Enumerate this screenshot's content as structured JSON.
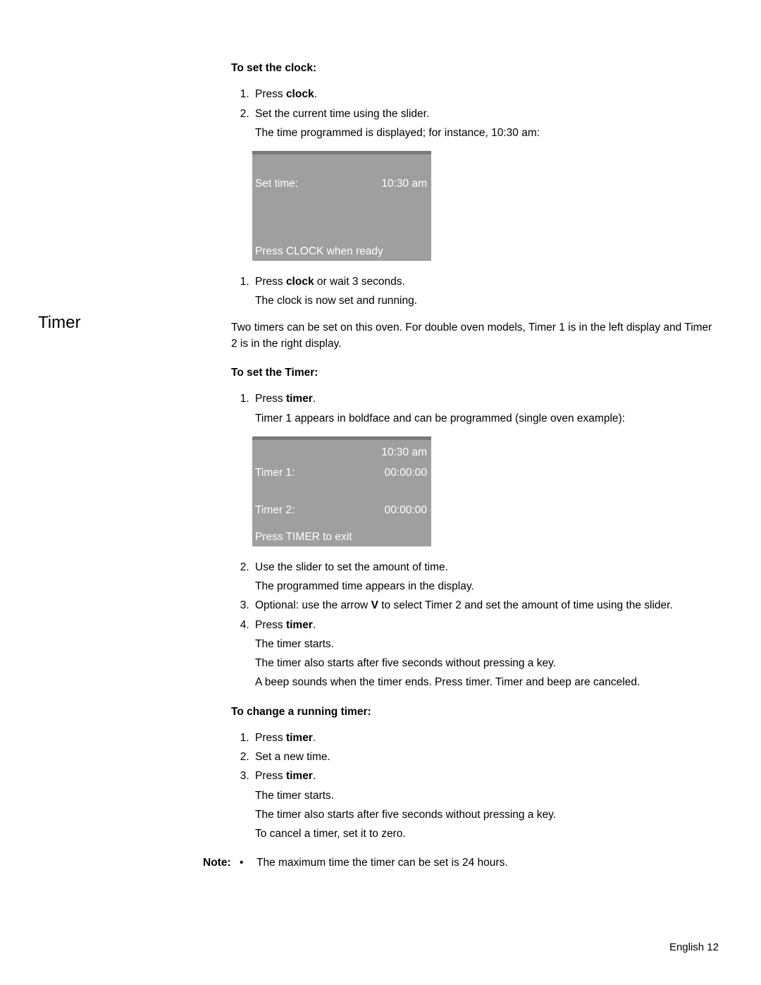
{
  "section1": {
    "heading": "To set the clock:",
    "steps_a": [
      {
        "pre": "Press ",
        "bold": "clock",
        "post": "."
      },
      {
        "text": "Set the current time using the slider.",
        "sub": "The time programmed is displayed; for instance, 10:30 am:"
      }
    ],
    "display": {
      "row1_left": "Set time:",
      "row1_right": "10:30 am",
      "bottom": "Press CLOCK when ready"
    },
    "steps_b": [
      {
        "pre": "Press ",
        "bold": "clock",
        "post": " or wait 3 seconds.",
        "sub": "The clock is now set and running."
      }
    ]
  },
  "section2": {
    "title": "Timer",
    "intro": "Two timers can be set on this oven. For double oven models, Timer 1 is in the left display and Timer 2 is in the right display.",
    "heading": "To set the Timer:",
    "steps_a": [
      {
        "pre": "Press ",
        "bold": "timer",
        "post": ".",
        "sub": "Timer 1 appears in boldface and can be programmed (single oven example):"
      }
    ],
    "display": {
      "top_right": "10:30 am",
      "row1_left": "Timer 1:",
      "row1_right": "00:00:00",
      "row2_left": "Timer 2:",
      "row2_right": "00:00:00",
      "bottom": "Press TIMER to exit"
    },
    "steps_b": [
      {
        "text": "Use the slider to set the amount of time.",
        "sub": "The programmed time appears in the display."
      },
      {
        "pre": "Optional: use the arrow ",
        "bold": "V",
        "post": " to select Timer 2 and set the amount of time using the slider."
      },
      {
        "pre": "Press ",
        "bold": "timer",
        "post": ".",
        "subs": [
          "The timer starts.",
          "The timer also starts after five seconds without pressing a key.",
          "A beep sounds when the timer ends. Press timer. Timer and beep are canceled."
        ]
      }
    ]
  },
  "section3": {
    "heading": "To change a running timer:",
    "steps": [
      {
        "pre": "Press ",
        "bold": "timer",
        "post": "."
      },
      {
        "text": "Set a new time."
      },
      {
        "pre": "Press ",
        "bold": "timer",
        "post": ".",
        "subs": [
          "The timer starts.",
          "The timer also starts after five seconds without pressing a key.",
          "To cancel a timer, set it to zero."
        ]
      }
    ]
  },
  "note": {
    "label": "Note:",
    "bullet": "•",
    "text": "The maximum time the timer can be set is 24 hours."
  },
  "footer": "English 12"
}
